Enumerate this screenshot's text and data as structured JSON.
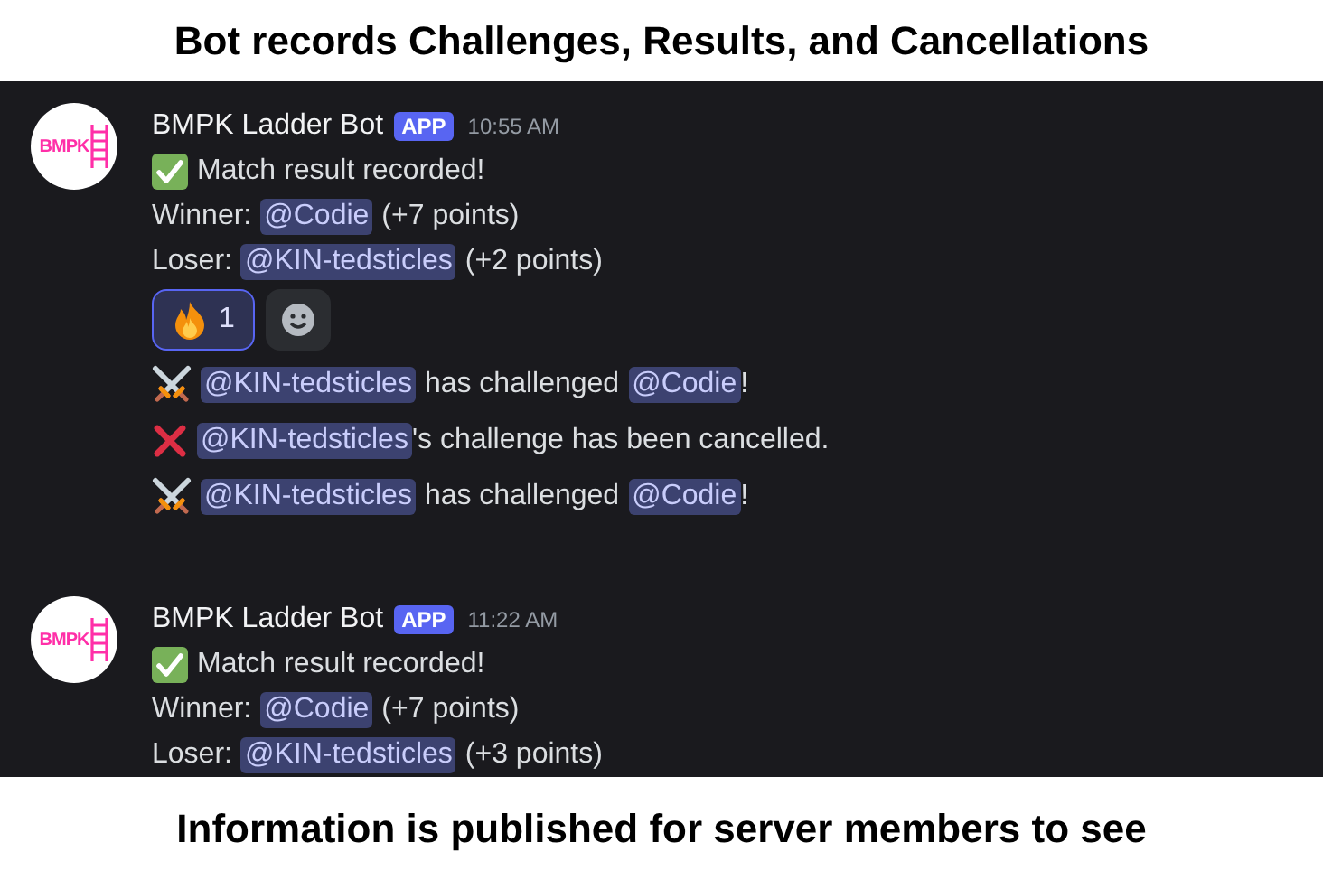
{
  "caption_top": "Bot records Challenges, Results, and Cancellations",
  "groups": [
    {
      "avatar_text": "BMPK",
      "author": "BMPK Ladder Bot",
      "badge": "APP",
      "time": "10:55 AM",
      "messages": [
        {
          "lines": [
            [
              {
                "kind": "check"
              },
              {
                "kind": "text",
                "text": "Match result recorded!"
              }
            ],
            [
              {
                "kind": "text",
                "text": "Winner:"
              },
              {
                "kind": "mention",
                "text": "@Codie"
              },
              {
                "kind": "text",
                "text": "(+7 points)"
              }
            ],
            [
              {
                "kind": "text",
                "text": "Loser:"
              },
              {
                "kind": "mention",
                "text": "@KIN-tedsticles"
              },
              {
                "kind": "text",
                "text": "(+2 points)"
              }
            ]
          ],
          "reactions": [
            {
              "kind": "fire",
              "count": "1",
              "selected": true
            }
          ]
        },
        {
          "lines": [
            [
              {
                "kind": "swords"
              },
              {
                "kind": "mention",
                "text": "@KIN-tedsticles"
              },
              {
                "kind": "text",
                "text": "has challenged"
              },
              {
                "kind": "mention",
                "text": "@Codie"
              },
              {
                "kind": "tail",
                "text": "!"
              }
            ]
          ]
        },
        {
          "lines": [
            [
              {
                "kind": "cross"
              },
              {
                "kind": "mention",
                "text": "@KIN-tedsticles"
              },
              {
                "kind": "tail",
                "text": "'s challenge has been cancelled."
              }
            ]
          ]
        },
        {
          "lines": [
            [
              {
                "kind": "swords"
              },
              {
                "kind": "mention",
                "text": "@KIN-tedsticles"
              },
              {
                "kind": "text",
                "text": "has challenged"
              },
              {
                "kind": "mention",
                "text": "@Codie"
              },
              {
                "kind": "tail",
                "text": "!"
              }
            ]
          ]
        }
      ]
    },
    {
      "avatar_text": "BMPK",
      "author": "BMPK Ladder Bot",
      "badge": "APP",
      "time": "11:22 AM",
      "messages": [
        {
          "lines": [
            [
              {
                "kind": "check"
              },
              {
                "kind": "text",
                "text": "Match result recorded!"
              }
            ],
            [
              {
                "kind": "text",
                "text": "Winner:"
              },
              {
                "kind": "mention",
                "text": "@Codie"
              },
              {
                "kind": "text",
                "text": "(+7 points)"
              }
            ],
            [
              {
                "kind": "text",
                "text": "Loser:"
              },
              {
                "kind": "mention",
                "text": "@KIN-tedsticles"
              },
              {
                "kind": "text",
                "text": "(+3 points)"
              }
            ]
          ]
        }
      ]
    }
  ],
  "caption_bottom": "Information is published for server members to see"
}
